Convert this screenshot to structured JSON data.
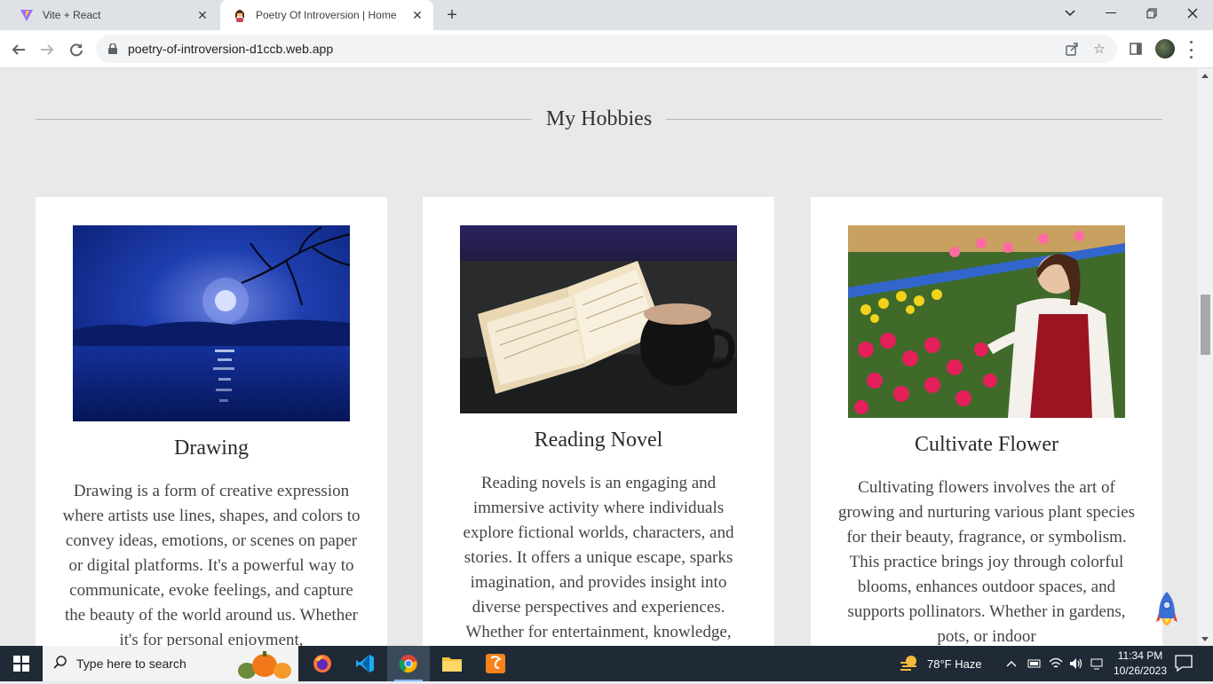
{
  "browser": {
    "tabs": [
      {
        "title": "Vite + React",
        "active": false
      },
      {
        "title": "Poetry Of Introversion | Home",
        "active": true
      }
    ],
    "url": "poetry-of-introversion-d1ccb.web.app"
  },
  "page": {
    "section_title": "My Hobbies",
    "cards": [
      {
        "title": "Drawing",
        "text": "Drawing is a form of creative expression where artists use lines, shapes, and colors to convey ideas, emotions, or scenes on paper or digital platforms. It's a powerful way to communicate, evoke feelings, and capture the beauty of the world around us. Whether it's for personal enjoyment,"
      },
      {
        "title": "Reading Novel",
        "text": "Reading novels is an engaging and immersive activity where individuals explore fictional worlds, characters, and stories. It offers a unique escape, sparks imagination, and provides insight into diverse perspectives and experiences. Whether for entertainment, knowledge,"
      },
      {
        "title": "Cultivate Flower",
        "text": "Cultivating flowers involves the art of growing and nurturing various plant species for their beauty, fragrance, or symbolism. This practice brings joy through colorful blooms, enhances outdoor spaces, and supports pollinators. Whether in gardens, pots, or indoor"
      }
    ]
  },
  "taskbar": {
    "search_placeholder": "Type here to search",
    "weather": "78°F  Haze",
    "time": "11:34 PM",
    "date": "10/26/2023"
  }
}
